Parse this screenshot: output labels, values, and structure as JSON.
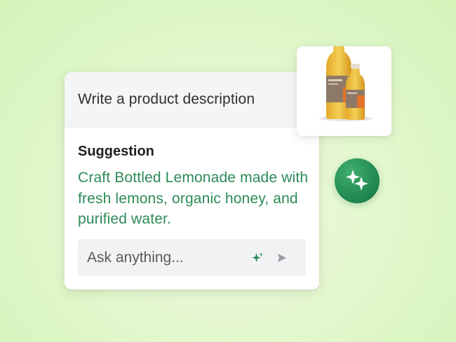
{
  "card": {
    "prompt": "Write a product description",
    "suggestion_label": "Suggestion",
    "suggestion_text": "Craft Bottled Lemonade made with fresh lemons, organic honey, and purified water."
  },
  "ask": {
    "placeholder": "Ask anything...",
    "sparkle_icon": "sparkle-icon",
    "send_icon": "send-icon"
  },
  "product_image": {
    "icon": "lemonade-bottles-image"
  },
  "ai_badge": {
    "icon": "sparkles-icon"
  },
  "colors": {
    "background": "#e4f8cf",
    "suggestion_text": "#2d8a57",
    "ai_badge": "#238a52"
  }
}
